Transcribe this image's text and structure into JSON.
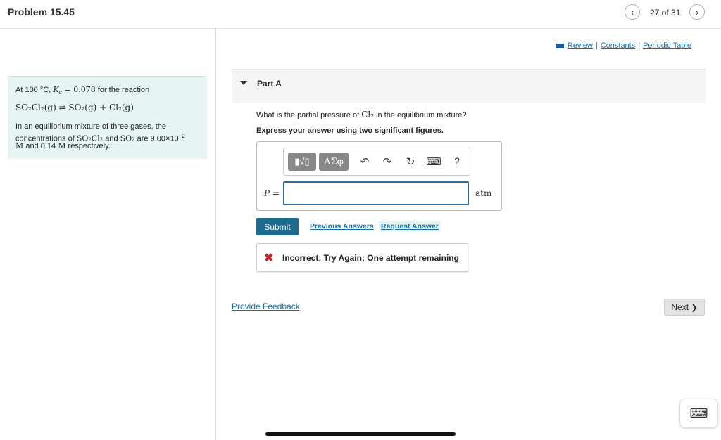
{
  "header": {
    "title": "Problem 15.45",
    "counter": "27 of 31",
    "prev_icon": "chevron-left-icon",
    "next_icon": "chevron-right-icon"
  },
  "problem": {
    "line1_prefix": "At 100 °C, ",
    "line1_math": "K",
    "line1_sub": "c",
    "line1_rest": " = 0.078",
    "line1_suffix": " for the reaction",
    "reaction": "SO₂Cl₂(g) ⇌ SO₂(g) + Cl₂(g)",
    "para_a": "In an equilibrium mixture of three gases, the",
    "para_b_1": "concentrations of ",
    "para_b_2": "SO₂Cl₂",
    "para_b_3": " and ",
    "para_b_4": "SO₂",
    "para_b_5": " are 9.00×10",
    "para_b_exp": "−2",
    "para_c_1": "M",
    "para_c_2": " and 0.14 ",
    "para_c_3": "M",
    "para_c_4": " respectively."
  },
  "links": {
    "review": "Review",
    "constants": "Constants",
    "periodic_table": "Periodic Table",
    "separator": "|"
  },
  "part": {
    "label": "Part A",
    "question_1": "What is the partial pressure of ",
    "question_2": "Cl₂",
    "question_3": " in the equilibrium mixture?",
    "instruction": "Express your answer using two significant figures."
  },
  "toolbar": {
    "templates_label": "▮√▯",
    "greek_label": "ΑΣφ",
    "undo": "↶",
    "redo": "↷",
    "reset": "↻",
    "keyboard": "⌨",
    "help": "?"
  },
  "answer": {
    "variable": "P =",
    "value": "",
    "unit": "atm"
  },
  "actions": {
    "submit": "Submit",
    "previous_answers": "Previous Answers",
    "request_answer": "Request Answer"
  },
  "feedback": {
    "icon": "✖",
    "message": "Incorrect; Try Again; One attempt remaining"
  },
  "footer": {
    "provide_feedback": "Provide Feedback",
    "next": "Next",
    "next_icon": "❯"
  },
  "colors": {
    "accent": "#1e6a8d",
    "link": "#1a6ea5",
    "error": "#c8202b",
    "problem_bg": "#e6f4f4"
  }
}
